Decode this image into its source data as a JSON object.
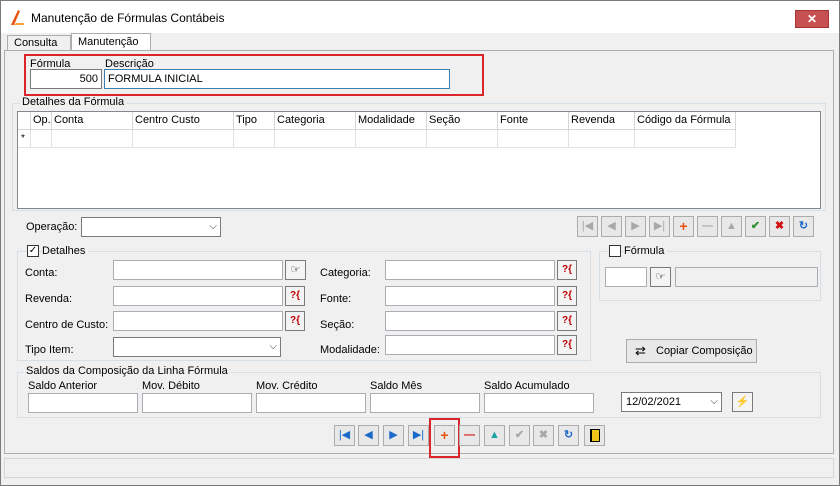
{
  "window": {
    "title": "Manutenção de Fórmulas Contábeis"
  },
  "tabs": [
    {
      "label": "Consulta"
    },
    {
      "label": "Manutenção"
    }
  ],
  "header": {
    "formula_label": "Fórmula",
    "formula_value": "500",
    "descricao_label": "Descrição",
    "descricao_value": "FORMULA INICIAL"
  },
  "details_grid": {
    "group_title": "Detalhes da Fórmula",
    "columns": [
      "Op.",
      "Conta",
      "Centro Custo",
      "Tipo",
      "Categoria",
      "Modalidade",
      "Seção",
      "Fonte",
      "Revenda",
      "Código da Fórmula"
    ],
    "new_row_marker": "*"
  },
  "operacao": {
    "label": "Operação:",
    "value": ""
  },
  "detalhes": {
    "title": "Detalhes",
    "checked": true,
    "conta_label": "Conta:",
    "revenda_label": "Revenda:",
    "centro_custo_label": "Centro de Custo:",
    "tipo_item_label": "Tipo Item:",
    "categoria_label": "Categoria:",
    "fonte_label": "Fonte:",
    "secao_label": "Seção:",
    "modalidade_label": "Modalidade:",
    "help_icon_text": "?{"
  },
  "formula_box": {
    "title": "Fórmula",
    "checked": false
  },
  "copiar_button": {
    "label": "Copiar Composição"
  },
  "saldos": {
    "title": "Saldos da Composição da Linha Fórmula",
    "saldo_anterior": "Saldo Anterior",
    "mov_debito": "Mov. Débito",
    "mov_credito": "Mov. Crédito",
    "saldo_mes": "Saldo Mês",
    "saldo_acumulado": "Saldo Acumulado",
    "date_value": "12/02/2021"
  },
  "colors": {
    "highlight": "#d9262b",
    "nav_blue": "#1b6ac9",
    "add_orange": "#e8530e"
  }
}
